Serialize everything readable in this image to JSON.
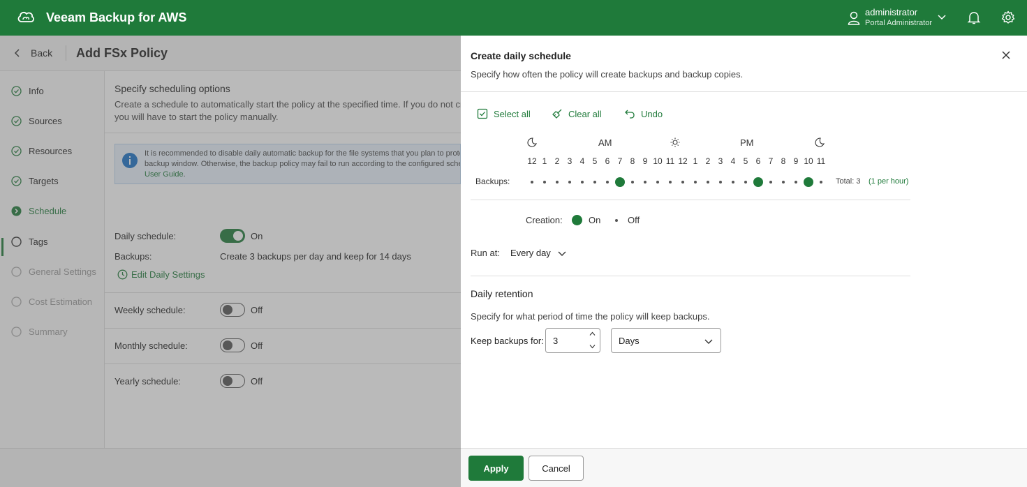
{
  "app": {
    "title": "Veeam Backup for AWS",
    "accent": "#1f7a3a",
    "user_name": "administrator",
    "user_role": "Portal Administrator"
  },
  "wizard": {
    "back_label": "Back",
    "title": "Add FSx Policy",
    "steps": [
      {
        "label": "Info",
        "state": "done"
      },
      {
        "label": "Sources",
        "state": "done"
      },
      {
        "label": "Resources",
        "state": "done"
      },
      {
        "label": "Targets",
        "state": "done"
      },
      {
        "label": "Schedule",
        "state": "active"
      },
      {
        "label": "Tags",
        "state": "pending"
      },
      {
        "label": "General Settings",
        "state": "disabled"
      },
      {
        "label": "Cost Estimation",
        "state": "disabled"
      },
      {
        "label": "Summary",
        "state": "disabled"
      }
    ],
    "section_title": "Specify scheduling options",
    "section_desc_line1": "Create a schedule to automatically start the policy at the specified time. If you do not create",
    "section_desc_line2": "you will have to start the policy manually.",
    "info_line1": "It is recommended to disable daily automatic backup for the file systems that you plan to protect",
    "info_line2": "backup window. Otherwise, the backup policy may fail to run according to the configured schedule",
    "info_link": "User Guide",
    "info_link_suffix": ".",
    "daily_label": "Daily schedule:",
    "daily_state": "On",
    "backups_label": "Backups:",
    "backups_value": "Create 3 backups per day and keep for 14 days",
    "edit_link": "Edit Daily Settings",
    "weekly_label": "Weekly schedule:",
    "weekly_state": "Off",
    "monthly_label": "Monthly schedule:",
    "monthly_state": "Off",
    "yearly_label": "Yearly schedule:",
    "yearly_state": "Off"
  },
  "panel": {
    "title": "Create daily schedule",
    "subtitle": "Specify how often the policy will create backups and backup copies.",
    "select_all": "Select all",
    "clear_all": "Clear all",
    "undo": "Undo",
    "am_label": "AM",
    "pm_label": "PM",
    "hours": [
      "12",
      "1",
      "2",
      "3",
      "4",
      "5",
      "6",
      "7",
      "8",
      "9",
      "10",
      "11",
      "12",
      "1",
      "2",
      "3",
      "4",
      "5",
      "6",
      "7",
      "8",
      "9",
      "10",
      "11"
    ],
    "backups_label": "Backups:",
    "selected_hours": [
      7,
      18,
      22
    ],
    "total": "Total: 3",
    "per_hour": "(1 per hour)",
    "creation_label": "Creation:",
    "creation_on": "On",
    "creation_off": "Off",
    "run_at_label": "Run at:",
    "run_at_value": "Every day",
    "retention_title": "Daily retention",
    "retention_desc": "Specify for what period of time the policy will keep backups.",
    "keep_label": "Keep backups for:",
    "keep_value": "3",
    "keep_unit": "Days",
    "apply": "Apply",
    "cancel": "Cancel"
  }
}
